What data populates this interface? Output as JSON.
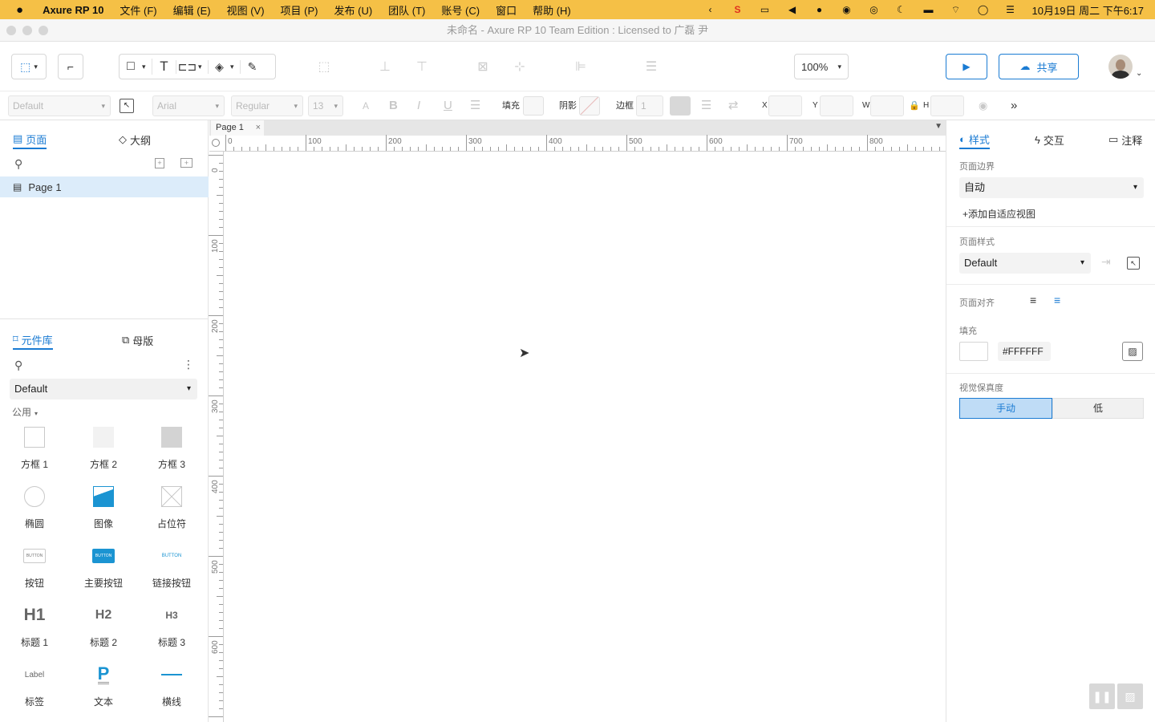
{
  "menubar": {
    "apple": "",
    "app": "Axure RP 10",
    "items": [
      "文件 (F)",
      "编辑 (E)",
      "视图 (V)",
      "项目 (P)",
      "发布 (U)",
      "团队 (T)",
      "账号 (C)",
      "窗口",
      "帮助 (H)"
    ],
    "clock": "10月19日 周二 下午6:17"
  },
  "window": {
    "title": "未命名 - Axure RP 10 Team Edition : Licensed to 广磊 尹"
  },
  "toolbar": {
    "zoom": "100%",
    "share_label": "共享"
  },
  "formatbar": {
    "style": "Default",
    "font": "Arial",
    "weight": "Regular",
    "size": "13",
    "fill_label": "填充",
    "shadow_label": "阴影",
    "border_label": "边框",
    "border_value": "1",
    "x_label": "X",
    "y_label": "Y",
    "w_label": "W",
    "h_label": "H"
  },
  "left": {
    "tabs": {
      "pages": "页面",
      "outline": "大纲"
    },
    "pages": [
      "Page 1"
    ],
    "lib_tabs": {
      "library": "元件库",
      "masters": "母版"
    },
    "library": "Default",
    "group": "公用",
    "widgets": [
      {
        "label": "方框 1",
        "icon": "box1-icon"
      },
      {
        "label": "方框 2",
        "icon": "box2-icon"
      },
      {
        "label": "方框 3",
        "icon": "box3-icon"
      },
      {
        "label": "椭圆",
        "icon": "ellipse-icon"
      },
      {
        "label": "图像",
        "icon": "image-icon"
      },
      {
        "label": "占位符",
        "icon": "placeholder-icon"
      },
      {
        "label": "按钮",
        "icon": "button-icon",
        "preview": "BUTTON"
      },
      {
        "label": "主要按钮",
        "icon": "primary-button-icon",
        "preview": "BUTTON"
      },
      {
        "label": "链接按钮",
        "icon": "link-button-icon",
        "preview": "BUTTON"
      },
      {
        "label": "标题 1",
        "icon": "heading1-icon",
        "preview": "H1"
      },
      {
        "label": "标题 2",
        "icon": "heading2-icon",
        "preview": "H2"
      },
      {
        "label": "标题 3",
        "icon": "heading3-icon",
        "preview": "H3"
      },
      {
        "label": "标签",
        "icon": "label-icon",
        "preview": "Label"
      },
      {
        "label": "文本",
        "icon": "text-icon",
        "preview": "P"
      },
      {
        "label": "横线",
        "icon": "hline-icon"
      }
    ]
  },
  "canvas": {
    "page_tab": "Page 1",
    "hticks": [
      "0",
      "100",
      "200",
      "300",
      "400",
      "500",
      "600",
      "700",
      "800"
    ],
    "vticks": [
      "0",
      "100",
      "200",
      "300",
      "400",
      "500",
      "600"
    ]
  },
  "right": {
    "tabs": {
      "style": "样式",
      "interact": "交互",
      "notes": "注释"
    },
    "page_dims_label": "页面边界",
    "page_dims_value": "自动",
    "add_adaptive": "添加自适应视图",
    "page_style_label": "页面样式",
    "page_style_value": "Default",
    "align_label": "页面对齐",
    "fill_label": "填充",
    "fill_value": "#FFFFFF",
    "fidelity_label": "视觉保真度",
    "fidelity_options": [
      "手动",
      "低"
    ]
  },
  "colors": {
    "accent": "#1a7bd3",
    "menubar": "#f5c046"
  }
}
